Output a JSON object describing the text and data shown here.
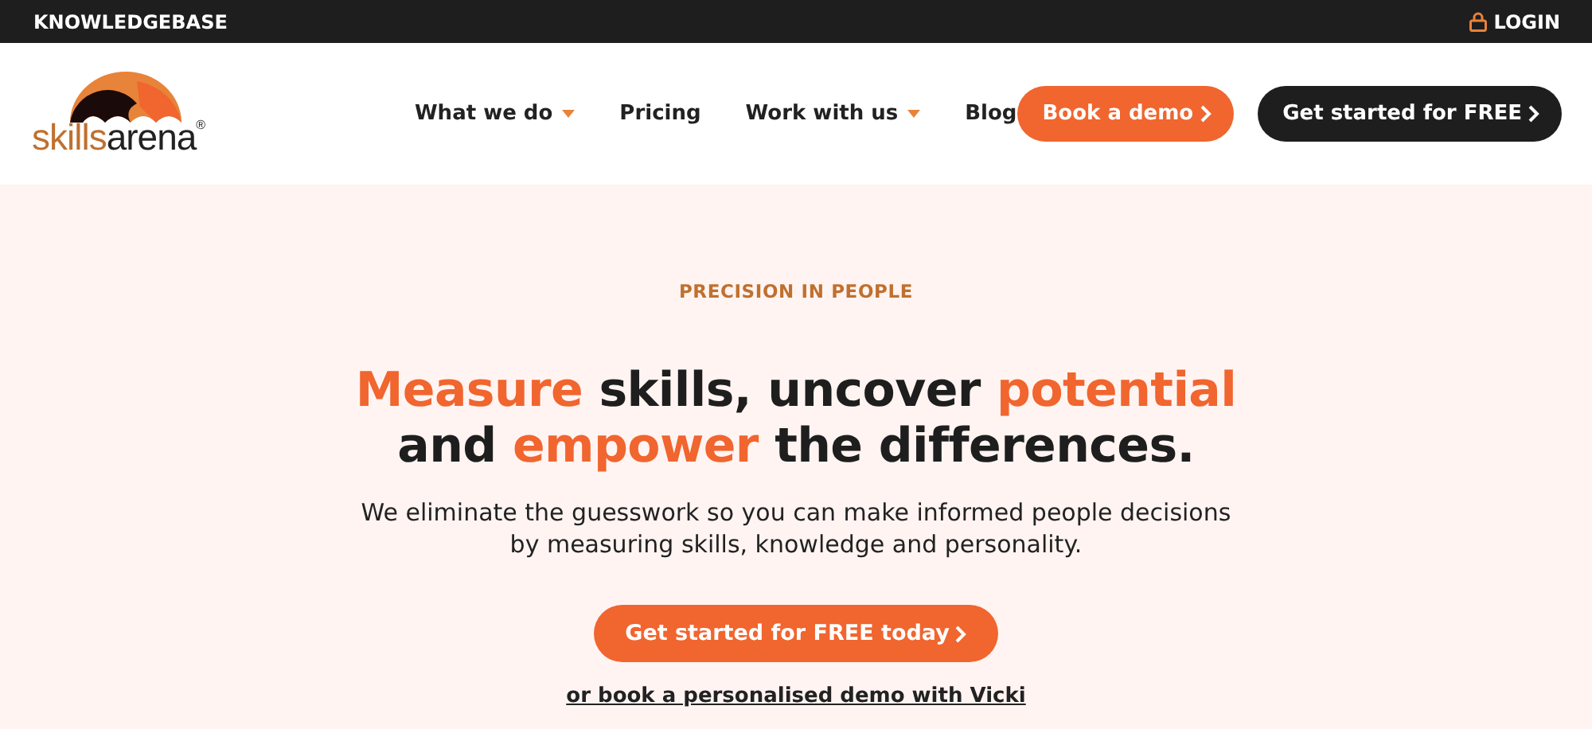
{
  "top_bar": {
    "left_link": "KNOWLEDGEBASE",
    "login": "LOGIN"
  },
  "logo": {
    "part_1": "skills",
    "part_2": "arena",
    "mark": "®"
  },
  "nav": [
    {
      "label": "What we do",
      "dropdown": true
    },
    {
      "label": "Pricing",
      "dropdown": false
    },
    {
      "label": "Work with us",
      "dropdown": true
    },
    {
      "label": "Blog",
      "dropdown": false
    }
  ],
  "nav_buttons": [
    {
      "label": "Book a demo",
      "kind": "primary"
    },
    {
      "label": "Get started for FREE",
      "kind": "dark"
    }
  ],
  "hero": {
    "eyebrow": "PRECISION IN PEOPLE",
    "headline": [
      [
        {
          "text": "Measure",
          "highlight": true
        },
        {
          "text": " skills, uncover ",
          "highlight": false
        },
        {
          "text": "potential",
          "highlight": true
        }
      ],
      [
        {
          "text": "and ",
          "highlight": false
        },
        {
          "text": "empower",
          "highlight": true
        },
        {
          "text": " the differences.",
          "highlight": false
        }
      ]
    ],
    "text": "We eliminate the guesswork so you can make informed people decisions by measuring skills, knowledge and personality.",
    "cta": "Get started for FREE today",
    "link": "or book a personalised demo with Vicki"
  }
}
